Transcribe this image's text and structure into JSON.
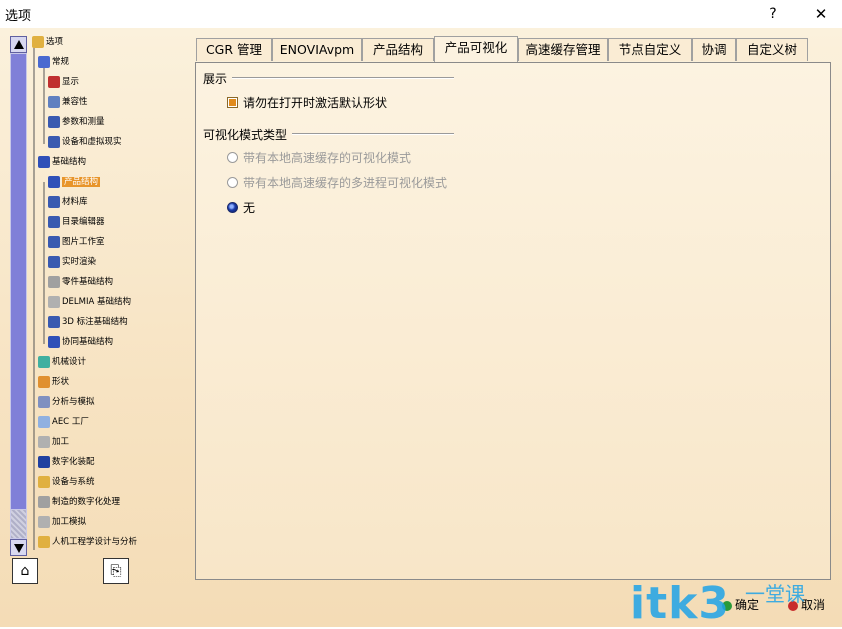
{
  "window": {
    "title": "选项",
    "help_label": "?",
    "close_label": "✕"
  },
  "tree": {
    "items": [
      {
        "label": "选项",
        "icon": "options-icon",
        "color": "#e0b040",
        "level": 0
      },
      {
        "label": "常规",
        "icon": "general-icon",
        "color": "#4a6ad0",
        "level": 1
      },
      {
        "label": "显示",
        "icon": "display-icon",
        "color": "#c03030",
        "level": 2
      },
      {
        "label": "兼容性",
        "icon": "compatibility-icon",
        "color": "#6080c0",
        "level": 2
      },
      {
        "label": "参数和测量",
        "icon": "parameters-icon",
        "color": "#3a5ab0",
        "level": 2
      },
      {
        "label": "设备和虚拟现实",
        "icon": "devices-icon",
        "color": "#3a5ab0",
        "level": 2
      },
      {
        "label": "基础结构",
        "icon": "infrastructure-icon",
        "color": "#3050b8",
        "level": 1
      },
      {
        "label": "产品结构",
        "icon": "product-structure-icon",
        "color": "#3050b8",
        "level": 2,
        "selected": true
      },
      {
        "label": "材料库",
        "icon": "material-library-icon",
        "color": "#3a5ab0",
        "level": 2
      },
      {
        "label": "目录编辑器",
        "icon": "catalog-editor-icon",
        "color": "#3a5ab0",
        "level": 2
      },
      {
        "label": "图片工作室",
        "icon": "photo-studio-icon",
        "color": "#3a5ab0",
        "level": 2
      },
      {
        "label": "实时渲染",
        "icon": "realtime-render-icon",
        "color": "#3a5ab0",
        "level": 2
      },
      {
        "label": "零件基础结构",
        "icon": "part-infrastructure-icon",
        "color": "#a0a0a0",
        "level": 2
      },
      {
        "label": "DELMIA 基础结构",
        "icon": "delmia-icon",
        "color": "#b0b0b0",
        "level": 2
      },
      {
        "label": "3D 标注基础结构",
        "icon": "3d-annotation-icon",
        "color": "#3a5ab0",
        "level": 2
      },
      {
        "label": "协同基础结构",
        "icon": "collaboration-icon",
        "color": "#3050b8",
        "level": 2
      },
      {
        "label": "机械设计",
        "icon": "mechanical-design-icon",
        "color": "#40b0a0",
        "level": 1
      },
      {
        "label": "形状",
        "icon": "shape-icon",
        "color": "#e09030",
        "level": 1
      },
      {
        "label": "分析与模拟",
        "icon": "analysis-icon",
        "color": "#8090c0",
        "level": 1
      },
      {
        "label": "AEC 工厂",
        "icon": "aec-plant-icon",
        "color": "#90b0e0",
        "level": 1
      },
      {
        "label": "加工",
        "icon": "machining-icon",
        "color": "#b0b0b0",
        "level": 1
      },
      {
        "label": "数字化装配",
        "icon": "digital-mockup-icon",
        "color": "#2040a0",
        "level": 1
      },
      {
        "label": "设备与系统",
        "icon": "equipment-icon",
        "color": "#e0b040",
        "level": 1
      },
      {
        "label": "制造的数字化处理",
        "icon": "manufacturing-icon",
        "color": "#a0a0a0",
        "level": 1
      },
      {
        "label": "加工模拟",
        "icon": "machining-sim-icon",
        "color": "#b0b0b0",
        "level": 1
      },
      {
        "label": "人机工程学设计与分析",
        "icon": "ergonomics-icon",
        "color": "#e0b040",
        "level": 1
      }
    ]
  },
  "tabs": [
    {
      "label": "CGR 管理"
    },
    {
      "label": "ENOVIAvpm"
    },
    {
      "label": "产品结构"
    },
    {
      "label": "产品可视化",
      "active": true
    },
    {
      "label": "高速缓存管理"
    },
    {
      "label": "节点自定义"
    },
    {
      "label": "协调"
    },
    {
      "label": "自定义树"
    }
  ],
  "panel": {
    "display_group": {
      "title": "展示",
      "checkbox_label": "请勿在打开时激活默认形状",
      "checked": true
    },
    "viz_group": {
      "title": "可视化模式类型",
      "options": [
        {
          "label": "带有本地高速缓存的可视化模式",
          "selected": false,
          "disabled": true
        },
        {
          "label": "带有本地高速缓存的多进程可视化模式",
          "selected": false,
          "disabled": true
        },
        {
          "label": "无",
          "selected": true,
          "disabled": false
        }
      ]
    }
  },
  "buttons": {
    "ok_label": "确定",
    "cancel_label": "取消"
  },
  "watermark": {
    "text": "itk3",
    "sub": "一堂课"
  }
}
